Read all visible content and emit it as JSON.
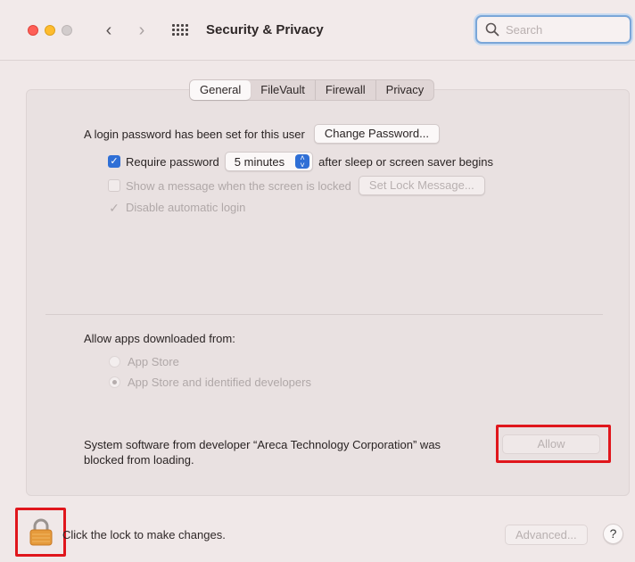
{
  "window": {
    "title": "Security & Privacy"
  },
  "toolbar": {
    "back_icon": "chevron-left",
    "forward_icon": "chevron-right",
    "grid_icon": "show-all-grid",
    "search_placeholder": "Search",
    "search_value": ""
  },
  "tabs": [
    {
      "label": "General",
      "active": true
    },
    {
      "label": "FileVault",
      "active": false
    },
    {
      "label": "Firewall",
      "active": false
    },
    {
      "label": "Privacy",
      "active": false
    }
  ],
  "general": {
    "login_password_text": "A login password has been set for this user",
    "change_password_button": "Change Password...",
    "require_password": {
      "checked": true,
      "label": "Require password",
      "interval": "5 minutes",
      "suffix": "after sleep or screen saver begins"
    },
    "show_message": {
      "checked": false,
      "enabled": false,
      "label": "Show a message when the screen is locked",
      "button": "Set Lock Message..."
    },
    "disable_auto_login": {
      "checked": true,
      "enabled": false,
      "label": "Disable automatic login"
    }
  },
  "allow_apps": {
    "heading": "Allow apps downloaded from:",
    "options": [
      {
        "label": "App Store",
        "selected": false
      },
      {
        "label": "App Store and identified developers",
        "selected": true
      }
    ]
  },
  "system_software": {
    "line1": "System software from developer “Areca Technology Corporation” was",
    "line2": "blocked from loading.",
    "allow_button": "Allow"
  },
  "footer": {
    "lock_icon": "padlock",
    "lock_text": "Click the lock to make changes.",
    "advanced_button": "Advanced...",
    "help_button": "?"
  },
  "colors": {
    "accent": "#2f6fd6",
    "highlight": "#e0161c",
    "background": "#f0e8e8"
  }
}
